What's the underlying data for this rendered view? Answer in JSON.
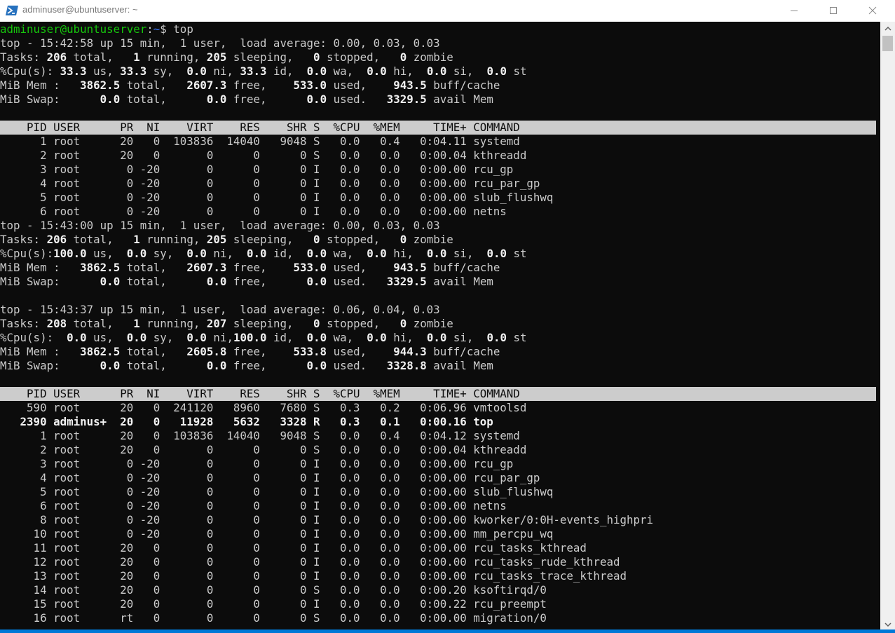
{
  "window": {
    "title": "adminuser@ubuntuserver: ~",
    "icon": "powershell-icon",
    "controls": [
      "minimize-icon",
      "maximize-icon",
      "close-icon"
    ]
  },
  "prompt": {
    "user_host": "adminuser@ubuntuserver",
    "sep": ":",
    "path": "~",
    "symbol": "$ ",
    "command": "top"
  },
  "terminal": {
    "colors": {
      "background": "#0c0c0c",
      "foreground": "#cccccc",
      "prompt_user": "#16c60c",
      "prompt_path": "#3b78ff",
      "header_bg": "#cccccc"
    },
    "lines": [
      {
        "type": "prompt"
      },
      {
        "type": "text",
        "segs": [
          [
            "top - 15:42:58 up 15 min,  1 user,  load average: 0.00, 0.03, 0.03",
            ""
          ]
        ]
      },
      {
        "type": "text",
        "segs": [
          [
            "Tasks: ",
            ""
          ],
          [
            "206",
            "b"
          ],
          [
            " total,   ",
            ""
          ],
          [
            "1",
            "b"
          ],
          [
            " running, ",
            ""
          ],
          [
            "205",
            "b"
          ],
          [
            " sleeping,   ",
            ""
          ],
          [
            "0",
            "b"
          ],
          [
            " stopped,   ",
            ""
          ],
          [
            "0",
            "b"
          ],
          [
            " zombie",
            ""
          ]
        ]
      },
      {
        "type": "text",
        "segs": [
          [
            "%Cpu(s): ",
            ""
          ],
          [
            "33.3",
            "b"
          ],
          [
            " us, ",
            ""
          ],
          [
            "33.3",
            "b"
          ],
          [
            " sy,  ",
            ""
          ],
          [
            "0.0",
            "b"
          ],
          [
            " ni, ",
            ""
          ],
          [
            "33.3",
            "b"
          ],
          [
            " id,  ",
            ""
          ],
          [
            "0.0",
            "b"
          ],
          [
            " wa,  ",
            ""
          ],
          [
            "0.0",
            "b"
          ],
          [
            " hi,  ",
            ""
          ],
          [
            "0.0",
            "b"
          ],
          [
            " si,  ",
            ""
          ],
          [
            "0.0",
            "b"
          ],
          [
            " st",
            ""
          ]
        ]
      },
      {
        "type": "text",
        "segs": [
          [
            "MiB Mem :   ",
            ""
          ],
          [
            "3862.5",
            "b"
          ],
          [
            " total,   ",
            ""
          ],
          [
            "2607.3",
            "b"
          ],
          [
            " free,    ",
            ""
          ],
          [
            "533.0",
            "b"
          ],
          [
            " used,    ",
            ""
          ],
          [
            "943.5",
            "b"
          ],
          [
            " buff/cache",
            ""
          ]
        ]
      },
      {
        "type": "text",
        "segs": [
          [
            "MiB Swap:      ",
            ""
          ],
          [
            "0.0",
            "b"
          ],
          [
            " total,      ",
            ""
          ],
          [
            "0.0",
            "b"
          ],
          [
            " free,      ",
            ""
          ],
          [
            "0.0",
            "b"
          ],
          [
            " used.   ",
            ""
          ],
          [
            "3329.5",
            "b"
          ],
          [
            " avail Mem",
            ""
          ]
        ]
      },
      {
        "type": "blank"
      },
      {
        "type": "header",
        "text": "    PID USER      PR  NI    VIRT    RES    SHR S  %CPU  %MEM     TIME+ COMMAND                                                                      "
      },
      {
        "type": "text",
        "segs": [
          [
            "      1 root      20   0  103836  14040   9048 S   0.0   0.4   0:04.11 systemd",
            ""
          ]
        ]
      },
      {
        "type": "text",
        "segs": [
          [
            "      2 root      20   0       0      0      0 S   0.0   0.0   0:00.04 kthreadd",
            ""
          ]
        ]
      },
      {
        "type": "text",
        "segs": [
          [
            "      3 root       0 -20       0      0      0 I   0.0   0.0   0:00.00 rcu_gp",
            ""
          ]
        ]
      },
      {
        "type": "text",
        "segs": [
          [
            "      4 root       0 -20       0      0      0 I   0.0   0.0   0:00.00 rcu_par_gp",
            ""
          ]
        ]
      },
      {
        "type": "text",
        "segs": [
          [
            "      5 root       0 -20       0      0      0 I   0.0   0.0   0:00.00 slub_flushwq",
            ""
          ]
        ]
      },
      {
        "type": "text",
        "segs": [
          [
            "      6 root       0 -20       0      0      0 I   0.0   0.0   0:00.00 netns",
            ""
          ]
        ]
      },
      {
        "type": "text",
        "segs": [
          [
            "top - 15:43:00 up 15 min,  1 user,  load average: 0.00, 0.03, 0.03",
            ""
          ]
        ]
      },
      {
        "type": "text",
        "segs": [
          [
            "Tasks: ",
            ""
          ],
          [
            "206",
            "b"
          ],
          [
            " total,   ",
            ""
          ],
          [
            "1",
            "b"
          ],
          [
            " running, ",
            ""
          ],
          [
            "205",
            "b"
          ],
          [
            " sleeping,   ",
            ""
          ],
          [
            "0",
            "b"
          ],
          [
            " stopped,   ",
            ""
          ],
          [
            "0",
            "b"
          ],
          [
            " zombie",
            ""
          ]
        ]
      },
      {
        "type": "text",
        "segs": [
          [
            "%Cpu(s):",
            ""
          ],
          [
            "100.0",
            "b"
          ],
          [
            " us,  ",
            ""
          ],
          [
            "0.0",
            "b"
          ],
          [
            " sy,  ",
            ""
          ],
          [
            "0.0",
            "b"
          ],
          [
            " ni,  ",
            ""
          ],
          [
            "0.0",
            "b"
          ],
          [
            " id,  ",
            ""
          ],
          [
            "0.0",
            "b"
          ],
          [
            " wa,  ",
            ""
          ],
          [
            "0.0",
            "b"
          ],
          [
            " hi,  ",
            ""
          ],
          [
            "0.0",
            "b"
          ],
          [
            " si,  ",
            ""
          ],
          [
            "0.0",
            "b"
          ],
          [
            " st",
            ""
          ]
        ]
      },
      {
        "type": "text",
        "segs": [
          [
            "MiB Mem :   ",
            ""
          ],
          [
            "3862.5",
            "b"
          ],
          [
            " total,   ",
            ""
          ],
          [
            "2607.3",
            "b"
          ],
          [
            " free,    ",
            ""
          ],
          [
            "533.0",
            "b"
          ],
          [
            " used,    ",
            ""
          ],
          [
            "943.5",
            "b"
          ],
          [
            " buff/cache",
            ""
          ]
        ]
      },
      {
        "type": "text",
        "segs": [
          [
            "MiB Swap:      ",
            ""
          ],
          [
            "0.0",
            "b"
          ],
          [
            " total,      ",
            ""
          ],
          [
            "0.0",
            "b"
          ],
          [
            " free,      ",
            ""
          ],
          [
            "0.0",
            "b"
          ],
          [
            " used.   ",
            ""
          ],
          [
            "3329.5",
            "b"
          ],
          [
            " avail Mem",
            ""
          ]
        ]
      },
      {
        "type": "blank"
      },
      {
        "type": "text",
        "segs": [
          [
            "top - 15:43:37 up 15 min,  1 user,  load average: 0.06, 0.04, 0.03",
            ""
          ]
        ]
      },
      {
        "type": "text",
        "segs": [
          [
            "Tasks: ",
            ""
          ],
          [
            "208",
            "b"
          ],
          [
            " total,   ",
            ""
          ],
          [
            "1",
            "b"
          ],
          [
            " running, ",
            ""
          ],
          [
            "207",
            "b"
          ],
          [
            " sleeping,   ",
            ""
          ],
          [
            "0",
            "b"
          ],
          [
            " stopped,   ",
            ""
          ],
          [
            "0",
            "b"
          ],
          [
            " zombie",
            ""
          ]
        ]
      },
      {
        "type": "text",
        "segs": [
          [
            "%Cpu(s):  ",
            ""
          ],
          [
            "0.0",
            "b"
          ],
          [
            " us,  ",
            ""
          ],
          [
            "0.0",
            "b"
          ],
          [
            " sy,  ",
            ""
          ],
          [
            "0.0",
            "b"
          ],
          [
            " ni,",
            ""
          ],
          [
            "100.0",
            "b"
          ],
          [
            " id,  ",
            ""
          ],
          [
            "0.0",
            "b"
          ],
          [
            " wa,  ",
            ""
          ],
          [
            "0.0",
            "b"
          ],
          [
            " hi,  ",
            ""
          ],
          [
            "0.0",
            "b"
          ],
          [
            " si,  ",
            ""
          ],
          [
            "0.0",
            "b"
          ],
          [
            " st",
            ""
          ]
        ]
      },
      {
        "type": "text",
        "segs": [
          [
            "MiB Mem :   ",
            ""
          ],
          [
            "3862.5",
            "b"
          ],
          [
            " total,   ",
            ""
          ],
          [
            "2605.8",
            "b"
          ],
          [
            " free,    ",
            ""
          ],
          [
            "533.8",
            "b"
          ],
          [
            " used,    ",
            ""
          ],
          [
            "944.3",
            "b"
          ],
          [
            " buff/cache",
            ""
          ]
        ]
      },
      {
        "type": "text",
        "segs": [
          [
            "MiB Swap:      ",
            ""
          ],
          [
            "0.0",
            "b"
          ],
          [
            " total,      ",
            ""
          ],
          [
            "0.0",
            "b"
          ],
          [
            " free,      ",
            ""
          ],
          [
            "0.0",
            "b"
          ],
          [
            " used.   ",
            ""
          ],
          [
            "3328.8",
            "b"
          ],
          [
            " avail Mem",
            ""
          ]
        ]
      },
      {
        "type": "blank"
      },
      {
        "type": "header",
        "text": "    PID USER      PR  NI    VIRT    RES    SHR S  %CPU  %MEM     TIME+ COMMAND                                                                      "
      },
      {
        "type": "text",
        "segs": [
          [
            "    590 root      20   0  241120   8960   7680 S   0.3   0.2   0:06.96 vmtoolsd",
            ""
          ]
        ]
      },
      {
        "type": "text",
        "segs": [
          [
            "   2390 adminus+  20   0   11928   5632   3328 R   0.3   0.1   0:00.16 top",
            "b"
          ]
        ]
      },
      {
        "type": "text",
        "segs": [
          [
            "      1 root      20   0  103836  14040   9048 S   0.0   0.4   0:04.12 systemd",
            ""
          ]
        ]
      },
      {
        "type": "text",
        "segs": [
          [
            "      2 root      20   0       0      0      0 S   0.0   0.0   0:00.04 kthreadd",
            ""
          ]
        ]
      },
      {
        "type": "text",
        "segs": [
          [
            "      3 root       0 -20       0      0      0 I   0.0   0.0   0:00.00 rcu_gp",
            ""
          ]
        ]
      },
      {
        "type": "text",
        "segs": [
          [
            "      4 root       0 -20       0      0      0 I   0.0   0.0   0:00.00 rcu_par_gp",
            ""
          ]
        ]
      },
      {
        "type": "text",
        "segs": [
          [
            "      5 root       0 -20       0      0      0 I   0.0   0.0   0:00.00 slub_flushwq",
            ""
          ]
        ]
      },
      {
        "type": "text",
        "segs": [
          [
            "      6 root       0 -20       0      0      0 I   0.0   0.0   0:00.00 netns",
            ""
          ]
        ]
      },
      {
        "type": "text",
        "segs": [
          [
            "      8 root       0 -20       0      0      0 I   0.0   0.0   0:00.00 kworker/0:0H-events_highpri",
            ""
          ]
        ]
      },
      {
        "type": "text",
        "segs": [
          [
            "     10 root       0 -20       0      0      0 I   0.0   0.0   0:00.00 mm_percpu_wq",
            ""
          ]
        ]
      },
      {
        "type": "text",
        "segs": [
          [
            "     11 root      20   0       0      0      0 I   0.0   0.0   0:00.00 rcu_tasks_kthread",
            ""
          ]
        ]
      },
      {
        "type": "text",
        "segs": [
          [
            "     12 root      20   0       0      0      0 I   0.0   0.0   0:00.00 rcu_tasks_rude_kthread",
            ""
          ]
        ]
      },
      {
        "type": "text",
        "segs": [
          [
            "     13 root      20   0       0      0      0 I   0.0   0.0   0:00.00 rcu_tasks_trace_kthread",
            ""
          ]
        ]
      },
      {
        "type": "text",
        "segs": [
          [
            "     14 root      20   0       0      0      0 S   0.0   0.0   0:00.20 ksoftirqd/0",
            ""
          ]
        ]
      },
      {
        "type": "text",
        "segs": [
          [
            "     15 root      20   0       0      0      0 I   0.0   0.0   0:00.22 rcu_preempt",
            ""
          ]
        ]
      },
      {
        "type": "text",
        "segs": [
          [
            "     16 root      rt   0       0      0      0 S   0.0   0.0   0:00.00 migration/0",
            ""
          ]
        ]
      }
    ]
  }
}
